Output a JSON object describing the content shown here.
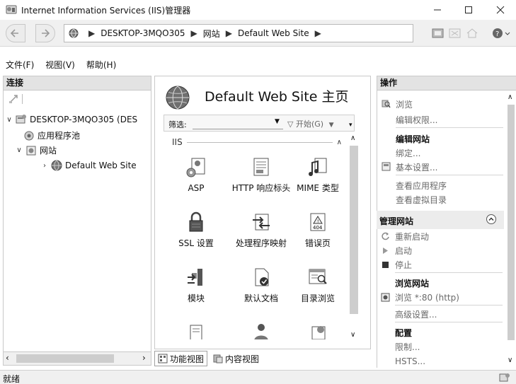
{
  "window": {
    "title": "Internet Information Services (IIS)管理器",
    "controls": [
      "minimize-icon",
      "maximize-icon",
      "close-icon"
    ]
  },
  "address": {
    "crumbs": [
      "DESKTOP-3MQO305",
      "网站",
      "Default Web Site"
    ]
  },
  "menu": {
    "items": [
      "文件(F)",
      "视图(V)",
      "帮助(H)"
    ]
  },
  "connections": {
    "header": "连接",
    "tree": [
      {
        "label": "DESKTOP-3MQO305 (DES",
        "icon": "server-icon",
        "expander": "expanded"
      },
      {
        "label": "应用程序池",
        "icon": "app-pool-icon"
      },
      {
        "label": "网站",
        "icon": "sites-folder-icon",
        "expander": "expanded"
      },
      {
        "label": "Default Web Site",
        "icon": "globe-icon",
        "expander": "collapsed",
        "selected": true
      }
    ]
  },
  "center": {
    "title": "Default Web Site 主页",
    "filter": {
      "label": "筛选:",
      "start": "开始(G)"
    },
    "group": "IIS",
    "features": [
      {
        "label": "ASP",
        "icon": "asp-icon"
      },
      {
        "label": "HTTP 响应标头",
        "icon": "http-response-headers-icon"
      },
      {
        "label": "MIME 类型",
        "icon": "mime-types-icon"
      },
      {
        "label": "SSL 设置",
        "icon": "ssl-lock-icon"
      },
      {
        "label": "处理程序映射",
        "icon": "handler-mappings-icon"
      },
      {
        "label": "错误页",
        "icon": "error-pages-icon"
      },
      {
        "label": "模块",
        "icon": "modules-icon"
      },
      {
        "label": "默认文档",
        "icon": "default-document-icon"
      },
      {
        "label": "目录浏览",
        "icon": "directory-browsing-icon"
      }
    ],
    "tabs": [
      {
        "label": "功能视图",
        "icon": "features-view-icon",
        "active": true
      },
      {
        "label": "内容视图",
        "icon": "content-view-icon",
        "active": false
      }
    ]
  },
  "actions": {
    "header": "操作",
    "items": {
      "explore": "浏览",
      "edit_permissions": "编辑权限...",
      "edit_site": "编辑网站",
      "bindings": "绑定...",
      "basic_settings": "基本设置...",
      "view_apps": "查看应用程序",
      "view_vdirs": "查看虚拟目录",
      "manage_site": "管理网站",
      "restart": "重新启动",
      "start": "启动",
      "stop": "停止",
      "browse_site": "浏览网站",
      "browse_80": "浏览 *:80 (http)",
      "advanced": "高级设置...",
      "configure": "配置",
      "limits": "限制...",
      "hsts": "HSTS..."
    }
  },
  "status": {
    "text": "就绪"
  }
}
